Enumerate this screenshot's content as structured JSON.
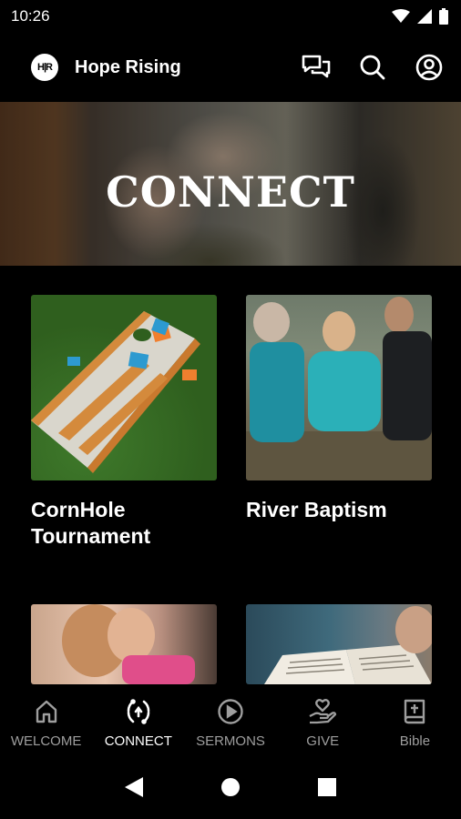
{
  "status_bar": {
    "time": "10:26"
  },
  "app_bar": {
    "logo_text": "H|R",
    "title": "Hope Rising"
  },
  "hero": {
    "title": "CONNECT"
  },
  "cards": [
    {
      "title": "CornHole Tournament",
      "image": "cornhole-board-photo"
    },
    {
      "title": "River Baptism",
      "image": "river-baptism-photo"
    },
    {
      "title": "",
      "image": "women-hugging-photo"
    },
    {
      "title": "",
      "image": "open-bible-photo"
    }
  ],
  "bottom_nav": {
    "items": [
      {
        "label": "WELCOME",
        "icon": "home-icon",
        "active": false
      },
      {
        "label": "CONNECT",
        "icon": "connect-icon",
        "active": true
      },
      {
        "label": "SERMONS",
        "icon": "play-circle-icon",
        "active": false
      },
      {
        "label": "GIVE",
        "icon": "give-hand-heart-icon",
        "active": false
      },
      {
        "label": "Bible",
        "icon": "bible-icon",
        "active": false
      }
    ]
  },
  "colors": {
    "background": "#000000",
    "text": "#ffffff",
    "inactive": "#9e9e9e"
  }
}
